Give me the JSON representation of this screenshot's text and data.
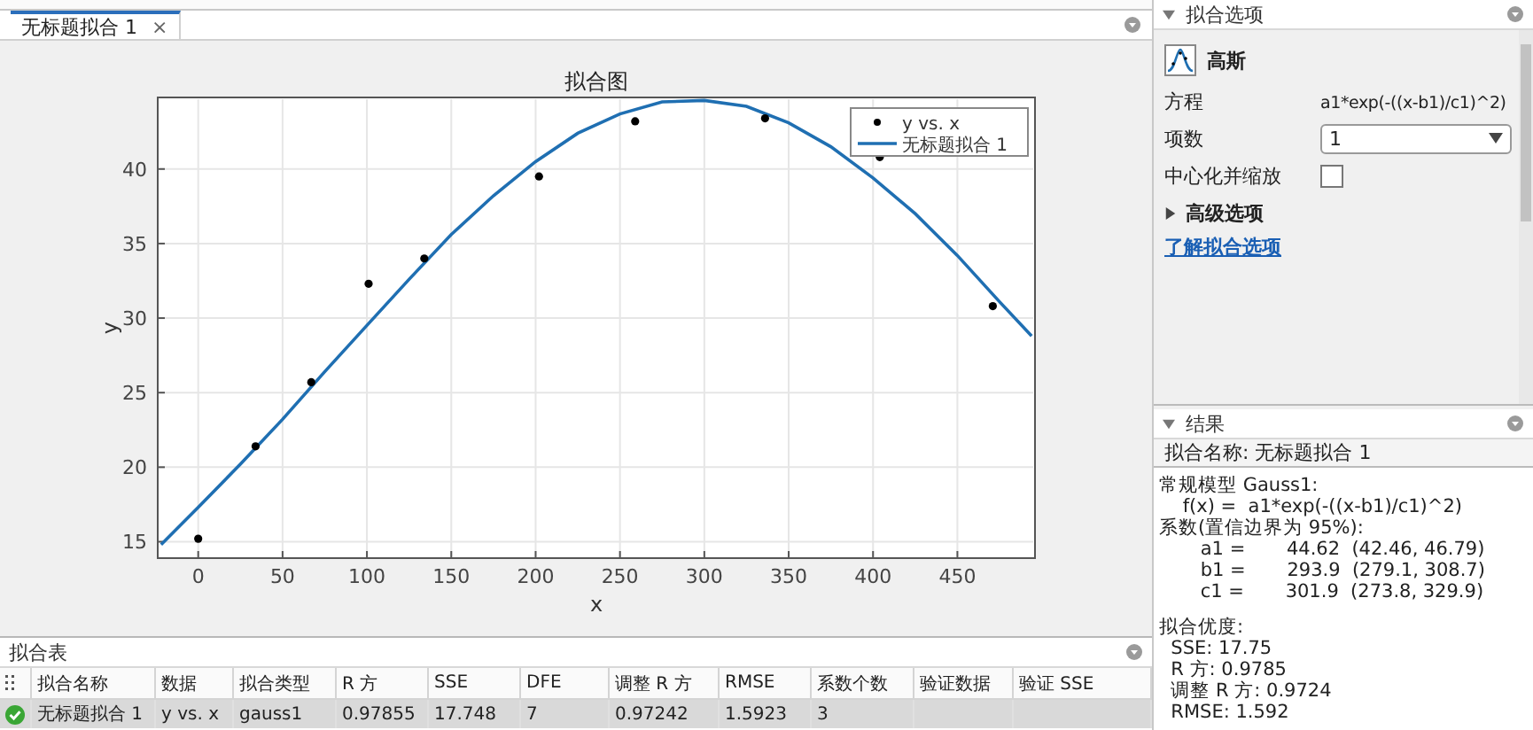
{
  "document_tabs": [
    {
      "label": "无标题拟合 1",
      "selected": true,
      "close": "×"
    }
  ],
  "plot": {
    "chart_data": {
      "type": "scatter",
      "title": "拟合图",
      "xlabel": "x",
      "ylabel": "y",
      "grid": true,
      "legend": true,
      "xlim": [
        -24,
        496
      ],
      "ylim": [
        13.9,
        44.8
      ],
      "xticks": [
        0,
        50,
        100,
        150,
        200,
        250,
        300,
        350,
        400,
        450
      ],
      "yticks": [
        15,
        20,
        25,
        30,
        35,
        40
      ],
      "series": [
        {
          "name": "y vs. x",
          "color": "#000000",
          "x": [
            0,
            34,
            67,
            101,
            134,
            202,
            259,
            336,
            404,
            471
          ],
          "values": [
            15.2,
            21.4,
            25.7,
            32.3,
            34.0,
            39.5,
            43.2,
            43.4,
            40.8,
            30.8
          ]
        },
        {
          "name": "无标题拟合 1",
          "type": "line",
          "color": "#1f6fb2",
          "x": [
            -22,
            0,
            25,
            50,
            75,
            100,
            125,
            150,
            175,
            200,
            225,
            250,
            275,
            300,
            325,
            350,
            375,
            400,
            425,
            450,
            475,
            494
          ],
          "values": [
            14.8,
            17.3,
            20.2,
            23.2,
            26.4,
            29.5,
            32.6,
            35.6,
            38.2,
            40.5,
            42.4,
            43.7,
            44.5,
            44.6,
            44.2,
            43.1,
            41.5,
            39.4,
            37.0,
            34.2,
            31.1,
            28.8
          ]
        }
      ]
    }
  },
  "fit_options": {
    "title": "拟合选项",
    "expanded": true,
    "fit_type": "高斯",
    "fields": [
      {
        "kind": "text",
        "label": "方程",
        "value": "a1*exp(-((x-b1)/c1)^2)"
      },
      {
        "kind": "dropdown",
        "label": "项数",
        "value": "1"
      },
      {
        "kind": "checkbox",
        "label": "中心化并缩放",
        "checked": false
      }
    ],
    "advanced": {
      "label": "高级选项",
      "expanded": false
    },
    "help_link": "了解拟合选项"
  },
  "results": {
    "title": "结果",
    "expanded": true,
    "fit_name": "拟合名称: 无标题拟合 1",
    "model_lines": [
      "常规模型 Gauss1:",
      "    f(x) =  a1*exp(-((x-b1)/c1)^2)",
      "系数(置信边界为 95%):",
      "       a1 =       44.62  (42.46, 46.79)",
      "       b1 =       293.9  (279.1, 308.7)",
      "       c1 =       301.9  (273.8, 329.9)"
    ],
    "goodness_lines": [
      "拟合优度:",
      "  SSE: 17.75",
      "  R 方: 0.9785",
      "  调整 R 方: 0.9724",
      "  RMSE: 1.592"
    ]
  },
  "fit_table": {
    "title": "拟合表",
    "columns": [
      "拟合名称",
      "数据",
      "拟合类型",
      "R 方",
      "SSE",
      "DFE",
      "调整 R 方",
      "RMSE",
      "系数个数",
      "验证数据",
      "验证 SSE"
    ],
    "rows": [
      {
        "valid": true,
        "selected": true,
        "cells": [
          "无标题拟合 1",
          "y vs. x",
          "gauss1",
          "0.97855",
          "17.748",
          "7",
          "0.97242",
          "1.5923",
          "3",
          "",
          ""
        ]
      }
    ]
  }
}
